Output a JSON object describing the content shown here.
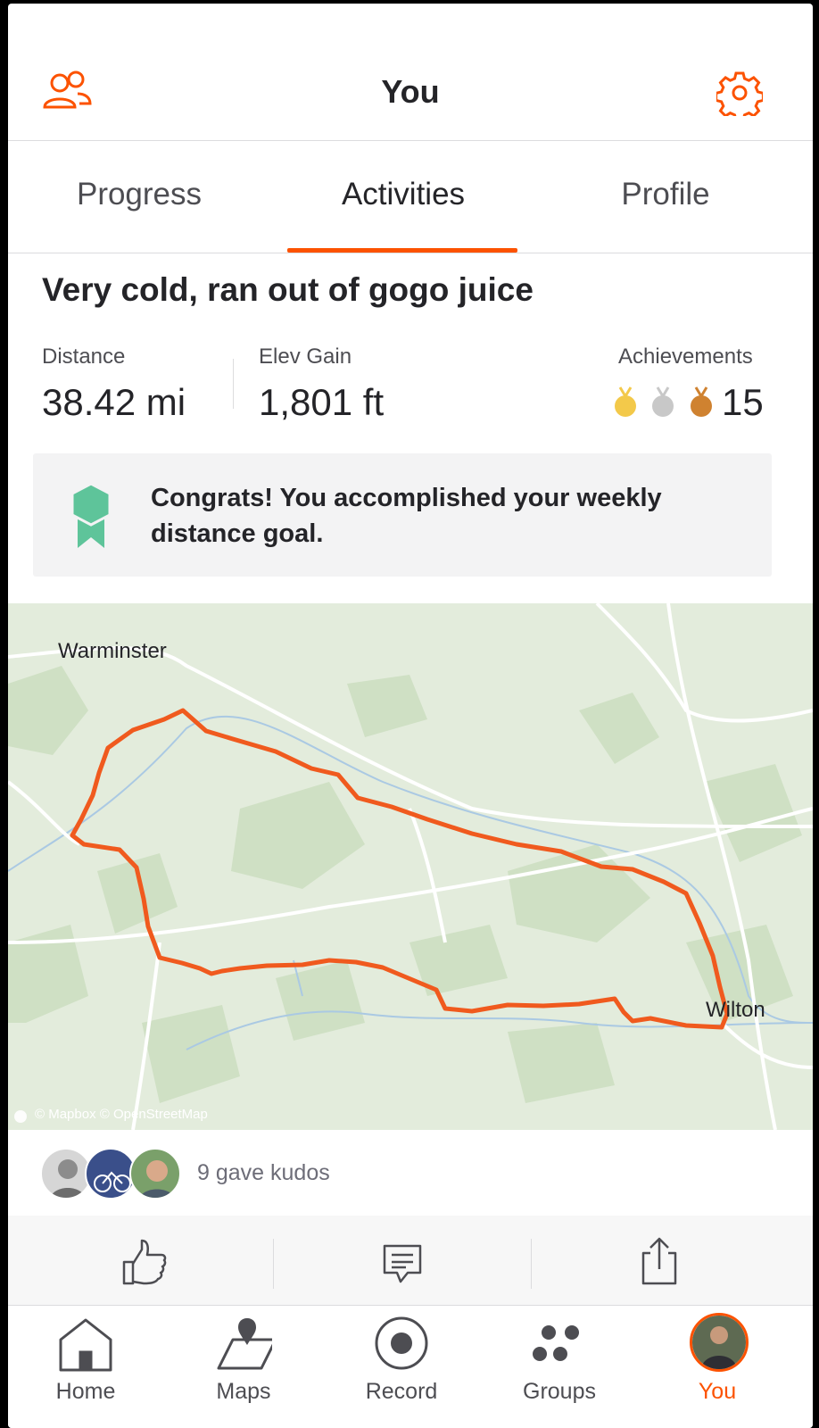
{
  "header": {
    "title": "You",
    "friends_icon": "friends-icon",
    "settings_icon": "gear-icon"
  },
  "tabs": [
    {
      "label": "Progress",
      "active": false
    },
    {
      "label": "Activities",
      "active": true
    },
    {
      "label": "Profile",
      "active": false
    }
  ],
  "activity": {
    "title": "Very cold, ran out of gogo juice",
    "stats": {
      "distance_label": "Distance",
      "distance_value": "38.42 mi",
      "elev_label": "Elev Gain",
      "elev_value": "1,801 ft",
      "achievements_label": "Achievements",
      "achievements_count": "15",
      "medals": [
        "gold-medal-icon",
        "silver-medal-icon",
        "bronze-medal-icon"
      ]
    },
    "goal_banner": {
      "icon": "goal-ribbon-icon",
      "text": "Congrats! You accomplished your weekly distance goal."
    },
    "map": {
      "labels": {
        "town1": "Warminster",
        "town2": "Wilton"
      },
      "attribution": "© Mapbox © OpenStreetMap"
    },
    "kudos": {
      "text": "9 gave kudos",
      "avatars": [
        "kudos-avatar-1",
        "kudos-avatar-2",
        "kudos-avatar-3"
      ]
    },
    "actions": [
      "thumbs-up-icon",
      "comment-icon",
      "share-icon"
    ]
  },
  "bottom_nav": [
    {
      "label": "Home",
      "icon": "home-icon",
      "active": false
    },
    {
      "label": "Maps",
      "icon": "map-icon",
      "active": false
    },
    {
      "label": "Record",
      "icon": "record-icon",
      "active": false
    },
    {
      "label": "Groups",
      "icon": "groups-icon",
      "active": false
    },
    {
      "label": "You",
      "icon": "profile-avatar",
      "active": true
    }
  ],
  "colors": {
    "accent": "#fc5200",
    "route": "#f05a1e",
    "goal_green": "#5ec49a",
    "gold": "#f3c94a",
    "silver": "#c8c8c8",
    "bronze": "#cf8230"
  }
}
